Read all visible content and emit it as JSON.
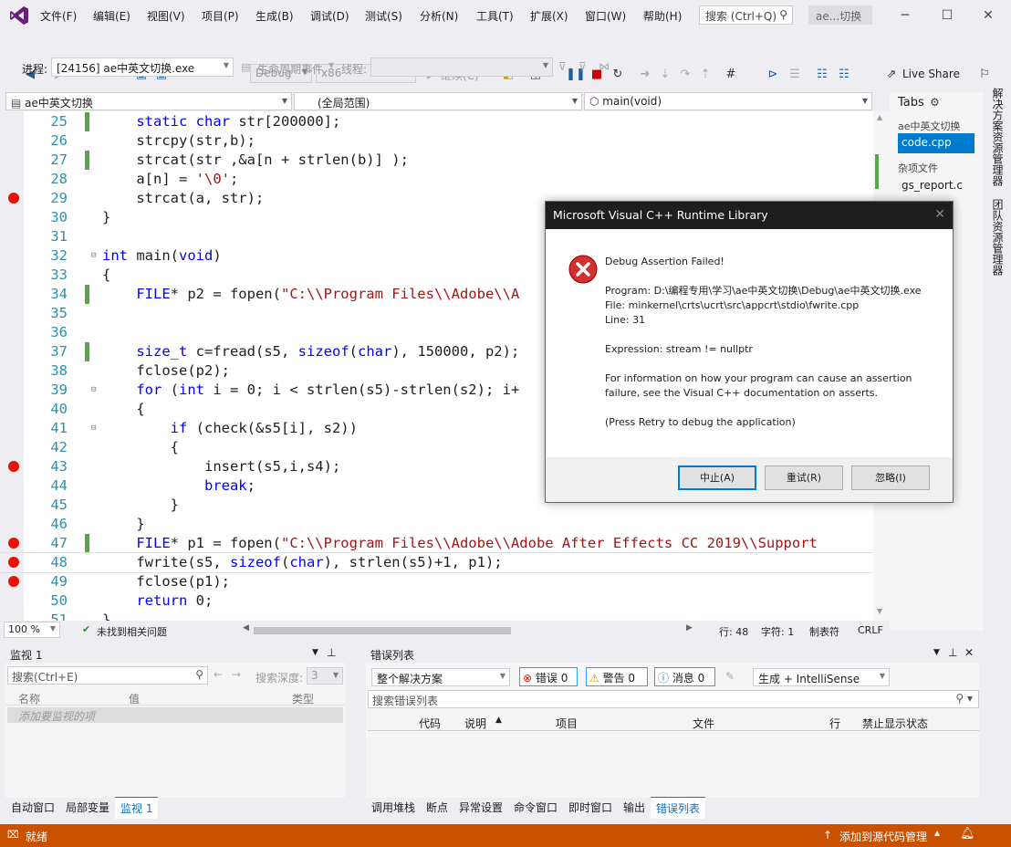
{
  "menubar": {
    "items": [
      "文件(F)",
      "编辑(E)",
      "视图(V)",
      "项目(P)",
      "生成(B)",
      "调试(D)",
      "测试(S)",
      "分析(N)",
      "工具(T)",
      "扩展(X)",
      "窗口(W)",
      "帮助(H)"
    ],
    "search_placeholder": "搜索 (Ctrl+Q)",
    "window_title": "ae...切换"
  },
  "toolbar": {
    "config": "Debug",
    "platform": "x86",
    "continue_label": "继续(C)",
    "live_share": "Live Share",
    "process_label": "进程:",
    "process_value": "[24156] ae中英文切换.exe",
    "lifecycle_label": "生命周期事件",
    "thread_label": "线程:"
  },
  "navbar": {
    "project": "ae中英文切换",
    "scope": "(全局范围)",
    "function": "main(void)"
  },
  "editor": {
    "lines": [
      {
        "num": "25",
        "html": "    <span class='k'>static</span> <span class='k'>char</span> str[200000];",
        "chg": true,
        "bp": false,
        "fold": ""
      },
      {
        "num": "26",
        "html": "    strcpy(str,b);",
        "chg": false,
        "bp": false,
        "fold": ""
      },
      {
        "num": "27",
        "html": "    strcat(str ,&a[n + strlen(b)] );",
        "chg": true,
        "bp": false,
        "fold": ""
      },
      {
        "num": "28",
        "html": "    a[n] = <span class='s'>'\\0'</span>;",
        "chg": false,
        "bp": false,
        "fold": ""
      },
      {
        "num": "29",
        "html": "    strcat(a, str);",
        "chg": false,
        "bp": true,
        "fold": ""
      },
      {
        "num": "30",
        "html": "}",
        "chg": false,
        "bp": false,
        "fold": ""
      },
      {
        "num": "31",
        "html": "",
        "chg": false,
        "bp": false,
        "fold": ""
      },
      {
        "num": "32",
        "html": "<span class='k'>int</span> main(<span class='k'>void</span>)",
        "chg": false,
        "bp": false,
        "fold": "⊟"
      },
      {
        "num": "33",
        "html": "{",
        "chg": false,
        "bp": false,
        "fold": ""
      },
      {
        "num": "34",
        "html": "    <span class='k'>FILE</span>* p2 = fopen(<span class='s'>\"C:\\\\Program Files\\\\Adobe\\\\A</span>",
        "chg": true,
        "bp": false,
        "fold": ""
      },
      {
        "num": "35",
        "html": "",
        "chg": false,
        "bp": false,
        "fold": ""
      },
      {
        "num": "36",
        "html": "",
        "chg": false,
        "bp": false,
        "fold": ""
      },
      {
        "num": "37",
        "html": "    <span class='k'>size_t</span> c=fread(s5, <span class='k'>sizeof</span>(<span class='k'>char</span>), 150000, p2);",
        "chg": true,
        "bp": false,
        "fold": ""
      },
      {
        "num": "38",
        "html": "    fclose(p2);",
        "chg": false,
        "bp": false,
        "fold": ""
      },
      {
        "num": "39",
        "html": "    <span class='k'>for</span> (<span class='k'>int</span> i = 0; i < strlen(s5)-strlen(s2); i+",
        "chg": false,
        "bp": false,
        "fold": "⊟"
      },
      {
        "num": "40",
        "html": "    {",
        "chg": false,
        "bp": false,
        "fold": ""
      },
      {
        "num": "41",
        "html": "        <span class='k'>if</span> (check(&s5[i], s2))",
        "chg": false,
        "bp": false,
        "fold": "⊟"
      },
      {
        "num": "42",
        "html": "        {",
        "chg": false,
        "bp": false,
        "fold": ""
      },
      {
        "num": "43",
        "html": "            insert(s5,i,s4);",
        "chg": false,
        "bp": true,
        "fold": ""
      },
      {
        "num": "44",
        "html": "            <span class='k'>break</span>;",
        "chg": false,
        "bp": false,
        "fold": ""
      },
      {
        "num": "45",
        "html": "        }",
        "chg": false,
        "bp": false,
        "fold": ""
      },
      {
        "num": "46",
        "html": "    }",
        "chg": false,
        "bp": false,
        "fold": ""
      },
      {
        "num": "47",
        "html": "    <span class='k'>FILE</span>* p1 = fopen(<span class='s'>\"C:\\\\Program Files\\\\Adobe\\\\Adobe After Effects CC 2019\\\\Support</span>",
        "chg": true,
        "bp": true,
        "fold": ""
      },
      {
        "num": "48",
        "html": "    fwrite(s5, <span class='k'>sizeof</span>(<span class='k'>char</span>), strlen(s5)+1, p1);",
        "chg": false,
        "bp": true,
        "fold": ""
      },
      {
        "num": "49",
        "html": "    fclose(p1);",
        "chg": false,
        "bp": true,
        "fold": ""
      },
      {
        "num": "50",
        "html": "    <span class='k'>return</span> 0;",
        "chg": false,
        "bp": false,
        "fold": ""
      },
      {
        "num": "51",
        "html": "}",
        "chg": false,
        "bp": false,
        "fold": ""
      }
    ]
  },
  "editor_status": {
    "zoom": "100 %",
    "issues": "未找到相关问题",
    "line": "行: 48",
    "char": "字符: 1",
    "tab": "制表符",
    "eol": "CRLF"
  },
  "solution_panel": {
    "title": "Tabs",
    "group1": "ae中英文切换",
    "file1": "code.cpp",
    "group2": "杂项文件",
    "file2": "gs_report.c"
  },
  "side_tabs": [
    "解决方案资源管理器",
    "团队资源管理器"
  ],
  "dialog": {
    "title": "Microsoft Visual C++ Runtime Library",
    "heading": "Debug Assertion Failed!",
    "program": "Program: D:\\编程专用\\学习\\ae中英文切换\\Debug\\ae中英文切换.exe",
    "file": "File: minkernel\\crts\\ucrt\\src\\appcrt\\stdio\\fwrite.cpp",
    "line": "Line: 31",
    "expression": "Expression: stream != nullptr",
    "info1": "For information on how your program can cause an assertion",
    "info2": "failure, see the Visual C++ documentation on asserts.",
    "press": "(Press Retry to debug the application)",
    "abort": "中止(A)",
    "retry": "重试(R)",
    "ignore": "忽略(I)"
  },
  "watch": {
    "title": "监视 1",
    "search_placeholder": "搜索(Ctrl+E)",
    "depth_label": "搜索深度:",
    "depth_value": "3",
    "col_name": "名称",
    "col_value": "值",
    "col_type": "类型",
    "add_hint": "添加要监视的项",
    "tabs": [
      "自动窗口",
      "局部变量",
      "监视 1"
    ]
  },
  "errorlist": {
    "title": "错误列表",
    "scope": "整个解决方案",
    "errors": "错误 0",
    "warnings": "警告 0",
    "messages": "消息 0",
    "build_filter": "生成 + IntelliSense",
    "search_placeholder": "搜索错误列表",
    "cols": [
      "代码",
      "说明",
      "项目",
      "文件",
      "行",
      "禁止显示状态"
    ],
    "tabs": [
      "调用堆栈",
      "断点",
      "异常设置",
      "命令窗口",
      "即时窗口",
      "输出",
      "错误列表"
    ]
  },
  "statusbar": {
    "state": "就绪",
    "source_control": "添加到源代码管理"
  },
  "colors": {
    "status_bar": "#ca5100",
    "keyword": "#0000ff",
    "string": "#a31515",
    "line_number": "#2b91af",
    "breakpoint": "#e51400",
    "dialog_titlebar": "#1e1e1e"
  }
}
